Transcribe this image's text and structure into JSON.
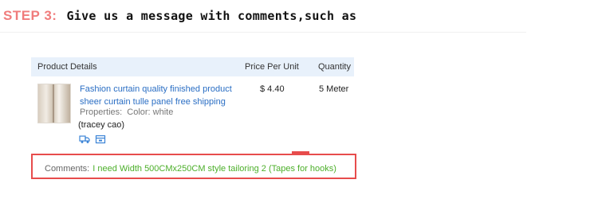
{
  "header": {
    "step_label": "STEP 3:",
    "step_text": "Give us a message with comments,such as"
  },
  "table": {
    "columns": {
      "product": "Product Details",
      "price": "Price Per Unit",
      "quantity": "Quantity"
    },
    "item": {
      "title_line1": "Fashion curtain quality finished product",
      "title_line2": "sheer curtain tulle panel free shipping",
      "properties_label": "Properties:",
      "properties_value": "Color: white",
      "buyer": "(tracey cao)",
      "price": "$ 4.40",
      "quantity": "5 Meter",
      "icons": [
        "shipping-truck-icon",
        "store-icon"
      ]
    }
  },
  "comments": {
    "label": "Comments:",
    "text": "I need Width 500CMx250CM style tailoring 2 (Tapes for hooks)"
  },
  "colors": {
    "step_label": "#f07c7c",
    "table_header_bg": "#e8f1fb",
    "link": "#2a6ec4",
    "comment_text": "#4caf2a",
    "highlight_border": "#e74c4c"
  }
}
